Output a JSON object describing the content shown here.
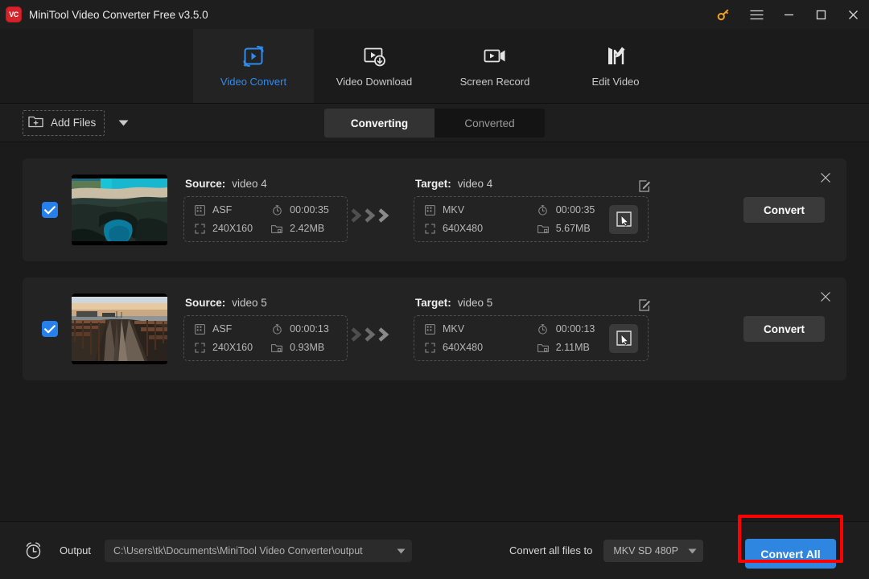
{
  "window": {
    "title": "MiniTool Video Converter Free v3.5.0",
    "logo_text": "VC",
    "controls": {
      "key": "key-icon",
      "menu": "hamburger-menu-icon",
      "minimize": "minimize-icon",
      "maximize": "maximize-icon",
      "close": "close-icon"
    }
  },
  "nav": {
    "tabs": [
      {
        "label": "Video Convert",
        "icon": "video-convert-icon",
        "active": true
      },
      {
        "label": "Video Download",
        "icon": "video-download-icon",
        "active": false
      },
      {
        "label": "Screen Record",
        "icon": "screen-record-icon",
        "active": false
      },
      {
        "label": "Edit Video",
        "icon": "edit-video-icon",
        "active": false
      }
    ]
  },
  "toolbar": {
    "add_files_label": "Add Files",
    "add_files_icon": "folder-plus-icon",
    "dropdown_icon": "chevron-down-icon",
    "segments": [
      {
        "label": "Converting",
        "active": true
      },
      {
        "label": "Converted",
        "active": false
      }
    ]
  },
  "files": [
    {
      "checked": true,
      "thumbnail": "tropical-coast-thumbnail",
      "source": {
        "label": "Source:",
        "name": "video 4",
        "format": "ASF",
        "duration": "00:00:35",
        "resolution": "240X160",
        "size": "2.42MB"
      },
      "target": {
        "label": "Target:",
        "name": "video 4",
        "format": "MKV",
        "duration": "00:00:35",
        "resolution": "640X480",
        "size": "5.67MB"
      },
      "convert_label": "Convert"
    },
    {
      "checked": true,
      "thumbnail": "sunset-pier-thumbnail",
      "source": {
        "label": "Source:",
        "name": "video 5",
        "format": "ASF",
        "duration": "00:00:13",
        "resolution": "240X160",
        "size": "0.93MB"
      },
      "target": {
        "label": "Target:",
        "name": "video 5",
        "format": "MKV",
        "duration": "00:00:13",
        "resolution": "640X480",
        "size": "2.11MB"
      },
      "convert_label": "Convert"
    }
  ],
  "bottom": {
    "clock_icon": "alarm-clock-icon",
    "output_label": "Output",
    "output_path": "C:\\Users\\tk\\Documents\\MiniTool Video Converter\\output",
    "convert_all_files_to_label": "Convert all files to",
    "format_preset": "MKV SD 480P",
    "convert_all_label": "Convert All"
  },
  "colors": {
    "accent_blue": "#2e86e0",
    "tab_active_blue": "#2e8cf0",
    "checkbox_blue": "#2680eb",
    "logo_red": "#d4232b",
    "key_gold": "#f0a020",
    "highlight_red": "#ff0000",
    "window_bg": "#1b1b1b",
    "card_bg": "#232323"
  }
}
